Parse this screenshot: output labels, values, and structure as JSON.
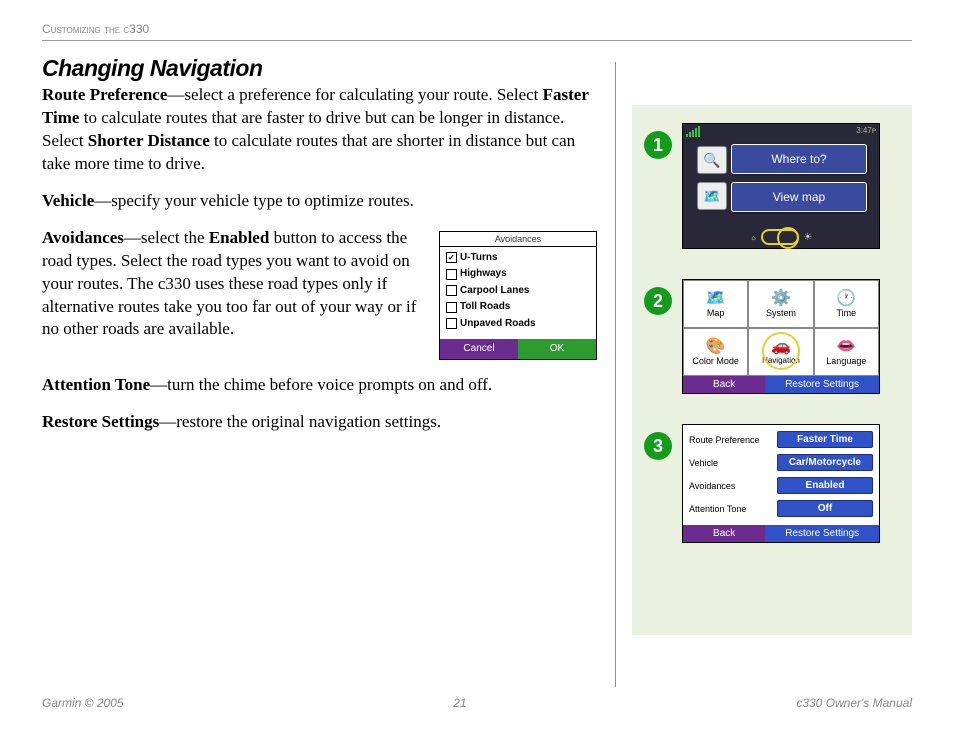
{
  "header": "Customizing the c330",
  "title": "Changing Navigation",
  "p1": {
    "lead": "Route Preference",
    "text1": "—select a preference for calculating your route. Select ",
    "b1": "Faster Time",
    "text2": " to calculate routes that are faster to drive but can be longer in distance. Select ",
    "b2": "Shorter Distance",
    "text3": " to calculate routes that are shorter in distance but can take more time to drive."
  },
  "p2": {
    "lead": "Vehicle",
    "text": "—specify your vehicle type to optimize routes."
  },
  "p3": {
    "lead": "Avoidances",
    "text1": "—select the ",
    "b1": "Enabled",
    "text2": " button to access the road types. Select the road types you want to avoid on your routes. The c330 uses these road types only if alternative routes take you too far out of your way or if no other roads are available."
  },
  "p4": {
    "lead": "Attention Tone",
    "text": "—turn the chime before voice prompts on and off."
  },
  "p5": {
    "lead": "Restore Settings",
    "text": "—restore the original navigation settings."
  },
  "avoidances_box": {
    "title": "Avoidances",
    "items": [
      "U-Turns",
      "Highways",
      "Carpool Lanes",
      "Toll Roads",
      "Unpaved Roads"
    ],
    "checked_index": 0,
    "cancel": "Cancel",
    "ok": "OK"
  },
  "steps": {
    "n1": "➊",
    "n2": "➋",
    "n3": "➌"
  },
  "shot1": {
    "time": "3:47ᴘ",
    "where": "Where to?",
    "view": "View map"
  },
  "shot2": {
    "cells": [
      "Map",
      "System",
      "Time",
      "Color Mode",
      "Navigation",
      "Language"
    ],
    "back": "Back",
    "restore": "Restore Settings"
  },
  "shot3": {
    "rows": [
      {
        "label": "Route Preference",
        "value": "Faster Time"
      },
      {
        "label": "Vehicle",
        "value": "Car/Motorcycle"
      },
      {
        "label": "Avoidances",
        "value": "Enabled"
      },
      {
        "label": "Attention Tone",
        "value": "Off"
      }
    ],
    "back": "Back",
    "restore": "Restore Settings"
  },
  "footer": {
    "left": "Garmin © 2005",
    "center": "21",
    "right": "c330 Owner's Manual"
  }
}
